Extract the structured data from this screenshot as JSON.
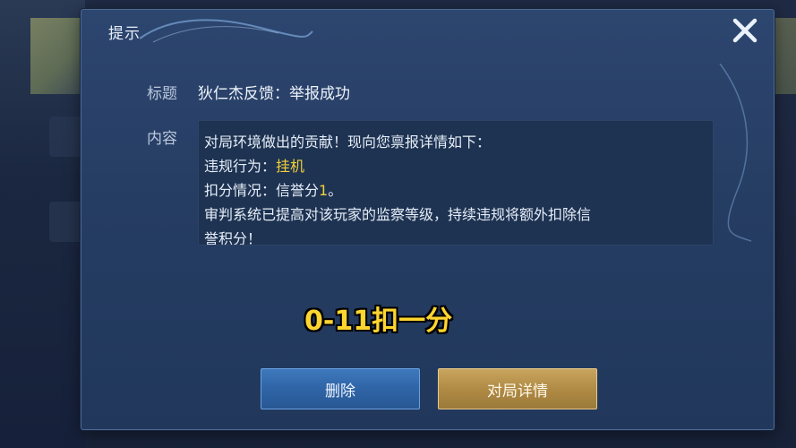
{
  "dialog": {
    "title": "提示",
    "close_icon": "close-icon",
    "subject_label": "标题",
    "subject_value": "狄仁杰反馈：举报成功",
    "content_label": "内容",
    "content": {
      "line1": "对局环境做出的贡献！现向您禀报详情如下：",
      "violation_prefix": "违规行为：",
      "violation_value": "挂机",
      "deduction_prefix": "扣分情况：信誉分",
      "deduction_value": "1",
      "deduction_suffix": "。",
      "line4": "审判系统已提高对该玩家的监察等级，持续违规将额外扣除信",
      "line5": "誉积分！"
    },
    "buttons": {
      "delete": "删除",
      "details": "对局详情"
    }
  },
  "overlay_caption": "0-11扣一分",
  "colors": {
    "highlight": "#f3cf3a",
    "dialog_bg": "#263d63",
    "delete_button": "#2f64a6",
    "details_button": "#b08b45"
  }
}
